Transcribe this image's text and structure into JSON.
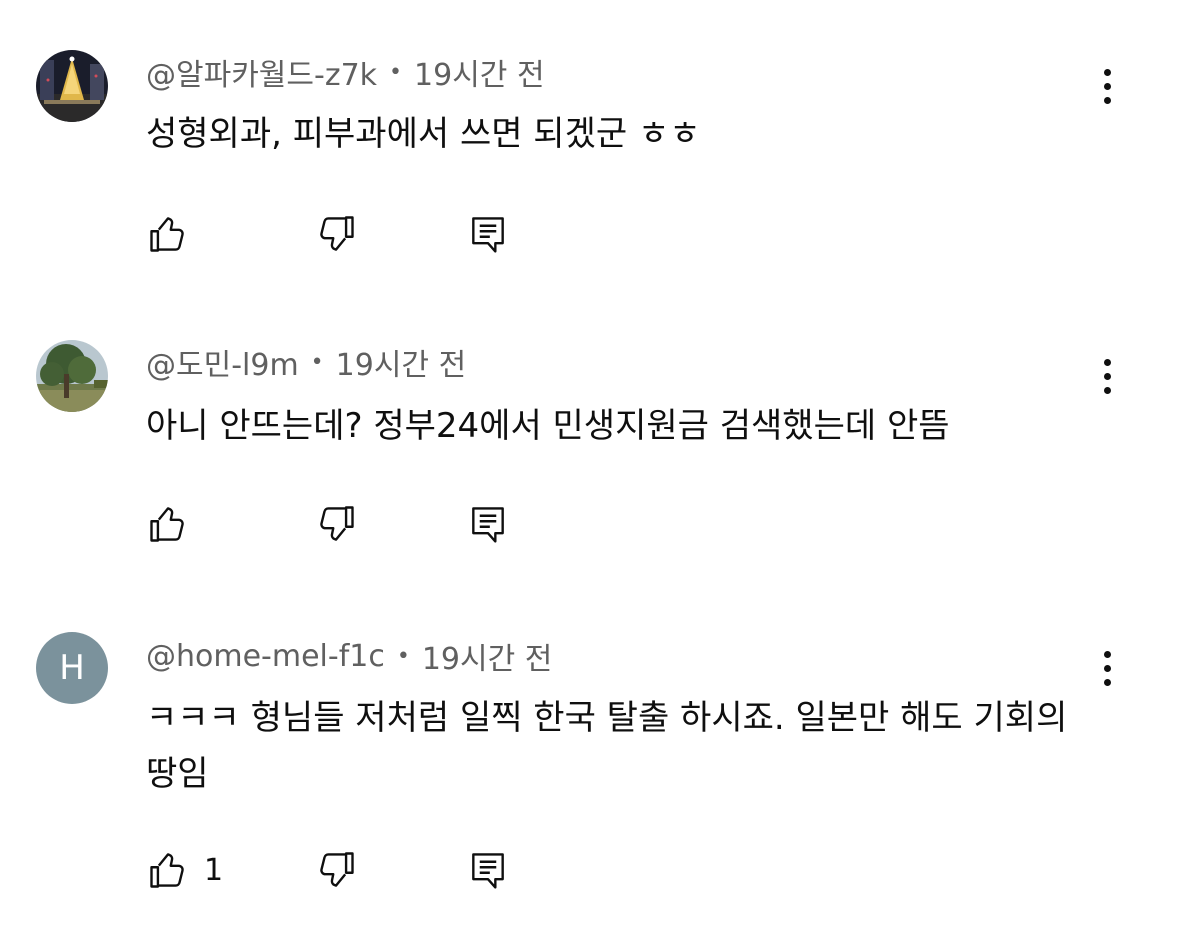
{
  "comments": [
    {
      "author": "@알파카월드-z7k",
      "time": "19시간 전",
      "text": "성형외과, 피부과에서 쓰면 되겠군 ㅎㅎ",
      "like_count": "",
      "avatar": "photo-christmas-tree"
    },
    {
      "author": "@도민-l9m",
      "time": "19시간 전",
      "text": "아니 안뜨는데? 정부24에서 민생지원금 검색했는데 안뜸",
      "like_count": "",
      "avatar": "photo-tree"
    },
    {
      "author": "@home-mel-f1c",
      "time": "19시간 전",
      "text": "ㅋㅋㅋ 형님들 저처럼 일찍 한국 탈출 하시죠. 일본만 해도 기회의땅임",
      "like_count": "1",
      "avatar_letter": "H",
      "avatar_color": "#7b929c"
    }
  ],
  "separator": "•",
  "icons": {
    "like": "thumb-up-icon",
    "dislike": "thumb-down-icon",
    "reply": "reply-comment-icon",
    "more": "more-vertical-icon"
  }
}
